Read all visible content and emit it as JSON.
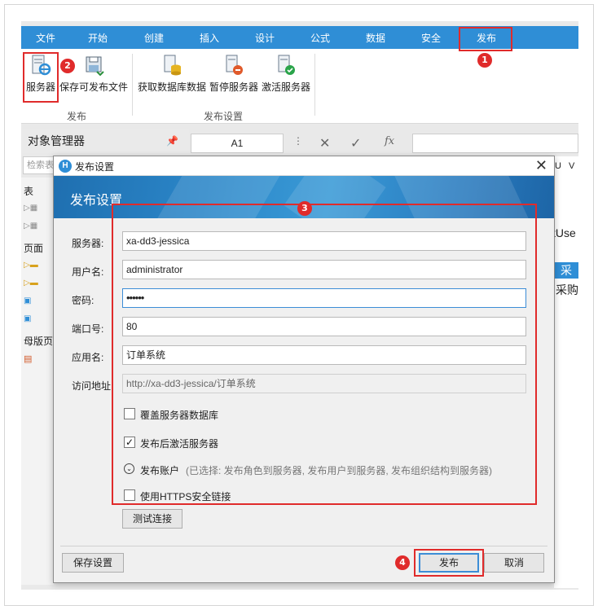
{
  "ribbon": {
    "tabs": [
      "文件",
      "开始",
      "创建",
      "插入",
      "设计",
      "公式",
      "数据",
      "安全",
      "发布"
    ],
    "active_tab": "发布",
    "buttons": {
      "server": "服务器",
      "save_publishable": "保存可发布文件",
      "get_db_data": "获取数据库数据",
      "pause_server": "暂停服务器",
      "activate_server": "激活服务器"
    },
    "groups": {
      "publish": "发布",
      "publish_settings": "发布设置"
    }
  },
  "object_manager": {
    "title": "对象管理器",
    "search_placeholder": "检索表",
    "sections": {
      "tables": "表",
      "pages": "页面",
      "master": "母版页"
    }
  },
  "formula_bar": {
    "cell_ref": "A1"
  },
  "sheet": {
    "col_u": "U",
    "col_v": "V",
    "text1": "tUse",
    "text2": "采",
    "text3": "采购"
  },
  "dialog": {
    "title": "发布设置",
    "banner_title": "发布设置",
    "fields": {
      "server_label": "服务器:",
      "server_value": "xa-dd3-jessica",
      "username_label": "用户名:",
      "username_value": "administrator",
      "password_label": "密码:",
      "password_value": "••••••",
      "port_label": "端口号:",
      "port_value": "80",
      "appname_label": "应用名:",
      "appname_value": "订单系统",
      "url_label": "访问地址:",
      "url_value": "http://xa-dd3-jessica/订单系统"
    },
    "options": {
      "overwrite_db": "覆盖服务器数据库",
      "overwrite_db_checked": false,
      "activate_after": "发布后激活服务器",
      "activate_after_checked": true,
      "publish_account": "发布账户",
      "publish_account_note": "(已选择: 发布角色到服务器, 发布用户到服务器, 发布组织结构到服务器)",
      "use_https": "使用HTTPS安全链接",
      "use_https_checked": false
    },
    "buttons": {
      "test_connection": "测试连接",
      "save_settings": "保存设置",
      "publish": "发布",
      "cancel": "取消"
    }
  },
  "annotations": {
    "badge1": "1",
    "badge2": "2",
    "badge3": "3",
    "badge4": "4"
  },
  "colors": {
    "ribbon_blue": "#2f8ed6",
    "annotation_red": "#e02b2b"
  }
}
